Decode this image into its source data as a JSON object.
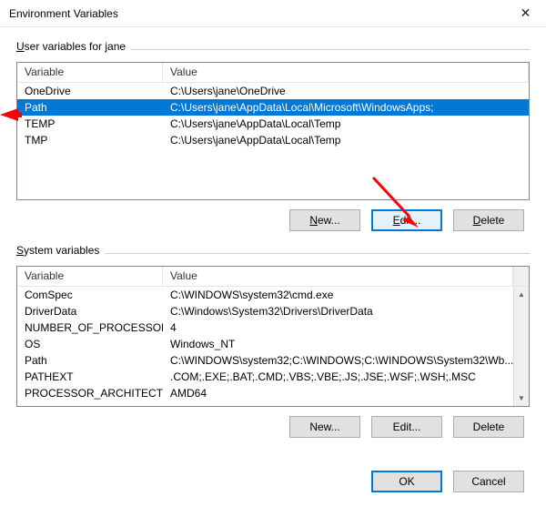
{
  "title": "Environment Variables",
  "user_section": {
    "label_prefix": "U",
    "label_rest": "ser variables for jane",
    "columns": {
      "variable": "Variable",
      "value": "Value"
    },
    "rows": [
      {
        "variable": "OneDrive",
        "value": "C:\\Users\\jane\\OneDrive",
        "selected": false
      },
      {
        "variable": "Path",
        "value": "C:\\Users\\jane\\AppData\\Local\\Microsoft\\WindowsApps;",
        "selected": true
      },
      {
        "variable": "TEMP",
        "value": "C:\\Users\\jane\\AppData\\Local\\Temp",
        "selected": false
      },
      {
        "variable": "TMP",
        "value": "C:\\Users\\jane\\AppData\\Local\\Temp",
        "selected": false
      }
    ],
    "buttons": {
      "new_u": "N",
      "new_rest": "ew...",
      "edit_u": "E",
      "edit_rest": "dit...",
      "delete_u": "D",
      "delete_rest": "elete"
    }
  },
  "system_section": {
    "label_prefix": "S",
    "label_rest": "ystem variables",
    "columns": {
      "variable": "Variable",
      "value": "Value"
    },
    "rows": [
      {
        "variable": "ComSpec",
        "value": "C:\\WINDOWS\\system32\\cmd.exe"
      },
      {
        "variable": "DriverData",
        "value": "C:\\Windows\\System32\\Drivers\\DriverData"
      },
      {
        "variable": "NUMBER_OF_PROCESSORS",
        "value": "4"
      },
      {
        "variable": "OS",
        "value": "Windows_NT"
      },
      {
        "variable": "Path",
        "value": "C:\\WINDOWS\\system32;C:\\WINDOWS;C:\\WINDOWS\\System32\\Wb..."
      },
      {
        "variable": "PATHEXT",
        "value": ".COM;.EXE;.BAT;.CMD;.VBS;.VBE;.JS;.JSE;.WSF;.WSH;.MSC"
      },
      {
        "variable": "PROCESSOR_ARCHITECTURE",
        "value": "AMD64"
      }
    ],
    "buttons": {
      "new": "New...",
      "edit": "Edit...",
      "delete": "Delete"
    }
  },
  "footer": {
    "ok": "OK",
    "cancel": "Cancel"
  },
  "glyphs": {
    "close": "✕",
    "up": "▲",
    "down": "▼"
  }
}
